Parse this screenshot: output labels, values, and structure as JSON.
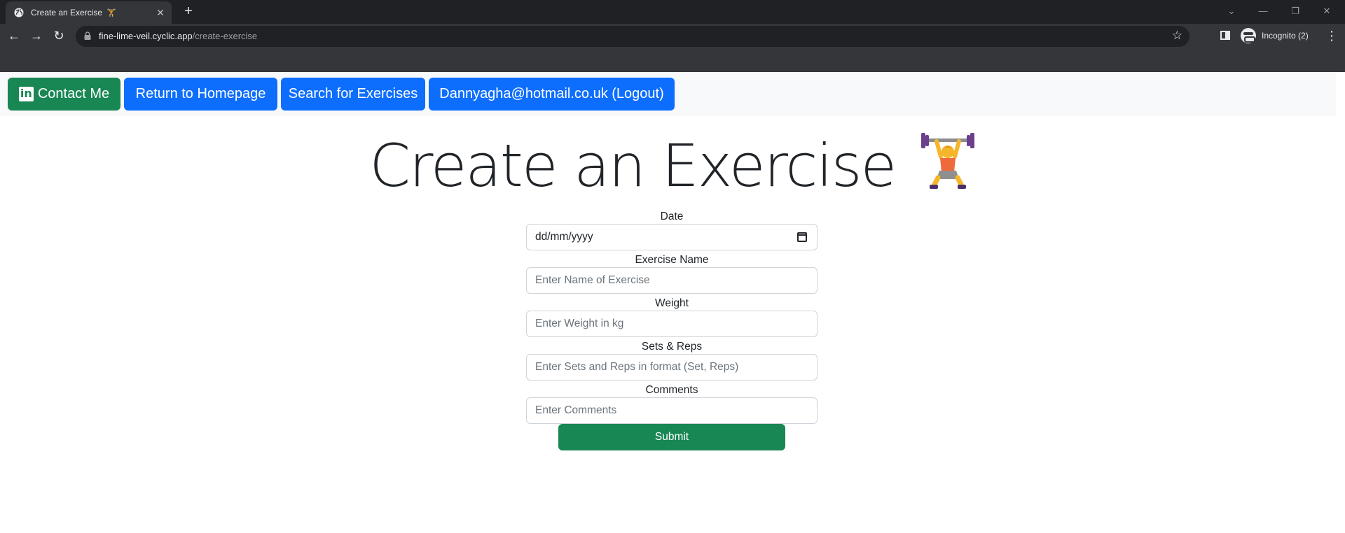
{
  "browser": {
    "tab_title": "Create an Exercise",
    "tab_emoji": "🏋",
    "url_host": "fine-lime-veil.cyclic.app",
    "url_path": "/create-exercise",
    "incognito_label": "Incognito (2)"
  },
  "navbar": {
    "contact": "Contact Me",
    "home": "Return to Homepage",
    "search": "Search for Exercises",
    "logout": "Dannyagha@hotmail.co.uk (Logout)"
  },
  "page": {
    "title": "Create an Exercise"
  },
  "form": {
    "date_label": "Date",
    "date_placeholder": "dd/mm/yyyy",
    "name_label": "Exercise Name",
    "name_placeholder": "Enter Name of Exercise",
    "weight_label": "Weight",
    "weight_placeholder": "Enter Weight in kg",
    "sets_label": "Sets & Reps",
    "sets_placeholder": "Enter Sets and Reps in format (Set, Reps)",
    "comments_label": "Comments",
    "comments_placeholder": "Enter Comments",
    "submit": "Submit"
  },
  "colors": {
    "success": "#198754",
    "primary": "#0d6efd",
    "chrome_dark": "#202124",
    "chrome_toolbar": "#35363a"
  },
  "icons": [
    "globe-icon",
    "close-icon",
    "plus-icon",
    "back-arrow-icon",
    "forward-arrow-icon",
    "reload-icon",
    "lock-icon",
    "star-icon",
    "side-panel-icon",
    "incognito-icon",
    "more-icon",
    "linkedin-icon",
    "weightlifter-icon",
    "calendar-icon"
  ]
}
